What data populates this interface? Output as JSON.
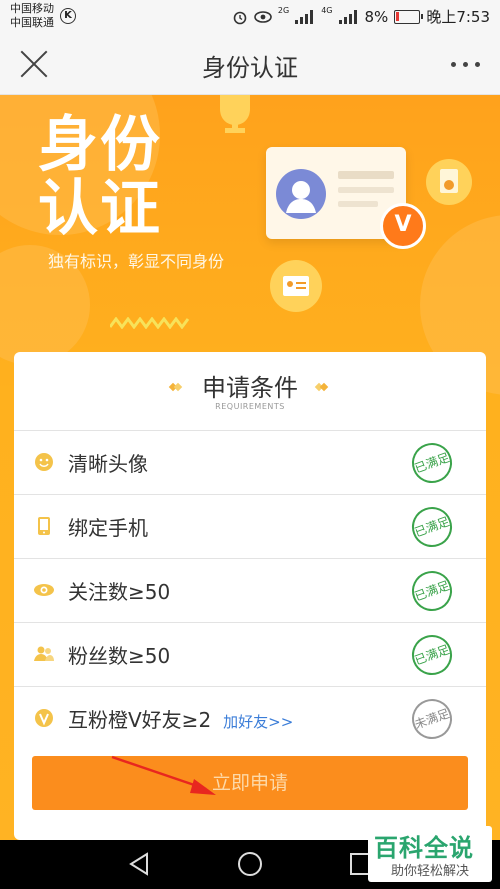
{
  "status_bar": {
    "carrier_1": "中国移动",
    "carrier_2": "中国联通",
    "k_badge": "K",
    "net_1": "2G",
    "net_2": "4G",
    "battery": "8%",
    "time": "晚上7:53"
  },
  "nav": {
    "title": "身份认证"
  },
  "banner": {
    "title_line1": "身份",
    "title_line2": "认证",
    "subtitle": "独有标识，彰显不同身份",
    "badge_letter": "V"
  },
  "requirements": {
    "title": "申请条件",
    "subtitle": "REQUIREMENTS",
    "items": [
      {
        "label": "清晰头像",
        "status": "已满足",
        "icon": "smile-icon"
      },
      {
        "label": "绑定手机",
        "status": "已满足",
        "icon": "phone-icon"
      },
      {
        "label": "关注数≥50",
        "status": "已满足",
        "icon": "eye-icon"
      },
      {
        "label": "粉丝数≥50",
        "status": "已满足",
        "icon": "fans-icon"
      },
      {
        "label": "互粉橙V好友≥2",
        "link": "加好友>>",
        "status": "未满足",
        "icon": "v-badge-icon"
      }
    ],
    "apply_button": "立即申请"
  },
  "watermark": {
    "brand": "百科全说",
    "tagline": "助你轻松解决"
  },
  "colors": {
    "accent": "#fb8d1d",
    "banner": "#ffa21c",
    "satisfied": "#3aa34a",
    "link": "#3b7dd8"
  }
}
